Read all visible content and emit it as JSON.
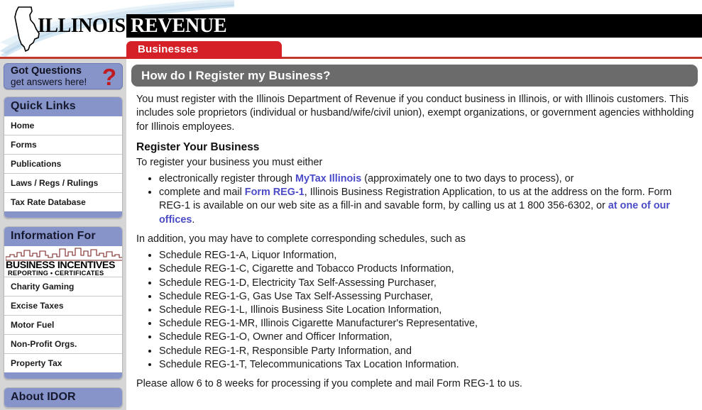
{
  "header": {
    "wordmark_illinois": "ILLINOIS",
    "wordmark_revenue": "REVENUE",
    "tab_label": "Businesses"
  },
  "sidebar": {
    "got_questions": {
      "line1": "Got Questions",
      "line2": "get answers here!",
      "mark": "?"
    },
    "quick_links": {
      "title": "Quick Links",
      "items": [
        {
          "label": "Home"
        },
        {
          "label": "Forms"
        },
        {
          "label": "Publications"
        },
        {
          "label": "Laws / Regs / Rulings"
        },
        {
          "label": "Tax Rate Database"
        }
      ]
    },
    "information_for": {
      "title": "Information For",
      "logo": {
        "title": "BUSINESS INCENTIVES",
        "subtitle": "REPORTING • CERTIFICATES"
      },
      "items": [
        {
          "label": "Charity Gaming"
        },
        {
          "label": "Excise Taxes"
        },
        {
          "label": "Motor Fuel"
        },
        {
          "label": "Non-Profit Orgs."
        },
        {
          "label": "Property Tax"
        }
      ]
    },
    "about_idor": {
      "title": "About IDOR"
    }
  },
  "main": {
    "page_title": "How do I Register my Business?",
    "intro": "You must register with the Illinois Department of Revenue if you conduct business in Illinois, or with Illinois customers. This includes sole proprietors (individual or husband/wife/civil union), exempt organizations, or government agencies withholding for Illinois employees.",
    "section_heading": "Register Your Business",
    "section_lead": "To register your business you must either",
    "register_options": {
      "option1_pre": "electronically register through ",
      "option1_link": "MyTax Illinois",
      "option1_post": " (approximately one to two days to process), or",
      "option2_pre": "complete and mail ",
      "option2_link": "Form REG-1",
      "option2_mid": ", Illinois Business Registration Application, to us at the address on the form. Form REG-1 is available on our web site as a fill-in and savable form, by calling us at 1 800 356-6302, or ",
      "option2_link2": "at one of our offices",
      "option2_post": "."
    },
    "schedules_lead": "In addition, you may have to complete corresponding schedules, such as",
    "schedules": [
      "Schedule REG-1-A, Liquor Information,",
      "Schedule REG-1-C, Cigarette and Tobacco Products Information,",
      "Schedule REG-1-D, Electricity Tax Self-Assessing Purchaser,",
      "Schedule REG-1-G, Gas Use Tax Self-Assessing Purchaser,",
      "Schedule REG-1-L, Illinois Business Site Location Information,",
      "Schedule REG-1-MR, Illinois Cigarette Manufacturer's Representative,",
      "Schedule REG-1-O, Owner and Officer Information,",
      "Schedule REG-1-R, Responsible Party Information, and",
      "Schedule REG-1-T, Telecommunications Tax Location Information."
    ],
    "closing": "Please allow 6 to 8 weeks for processing if you complete and mail Form REG-1 to us."
  },
  "colors": {
    "brand_red": "#d42026",
    "rule_red": "#c0392b",
    "panel_blue": "#8694c9",
    "header_gray": "#6b6b6b",
    "link_blue": "#4b4bc8",
    "sidebar_bg": "#d6d6d6"
  }
}
